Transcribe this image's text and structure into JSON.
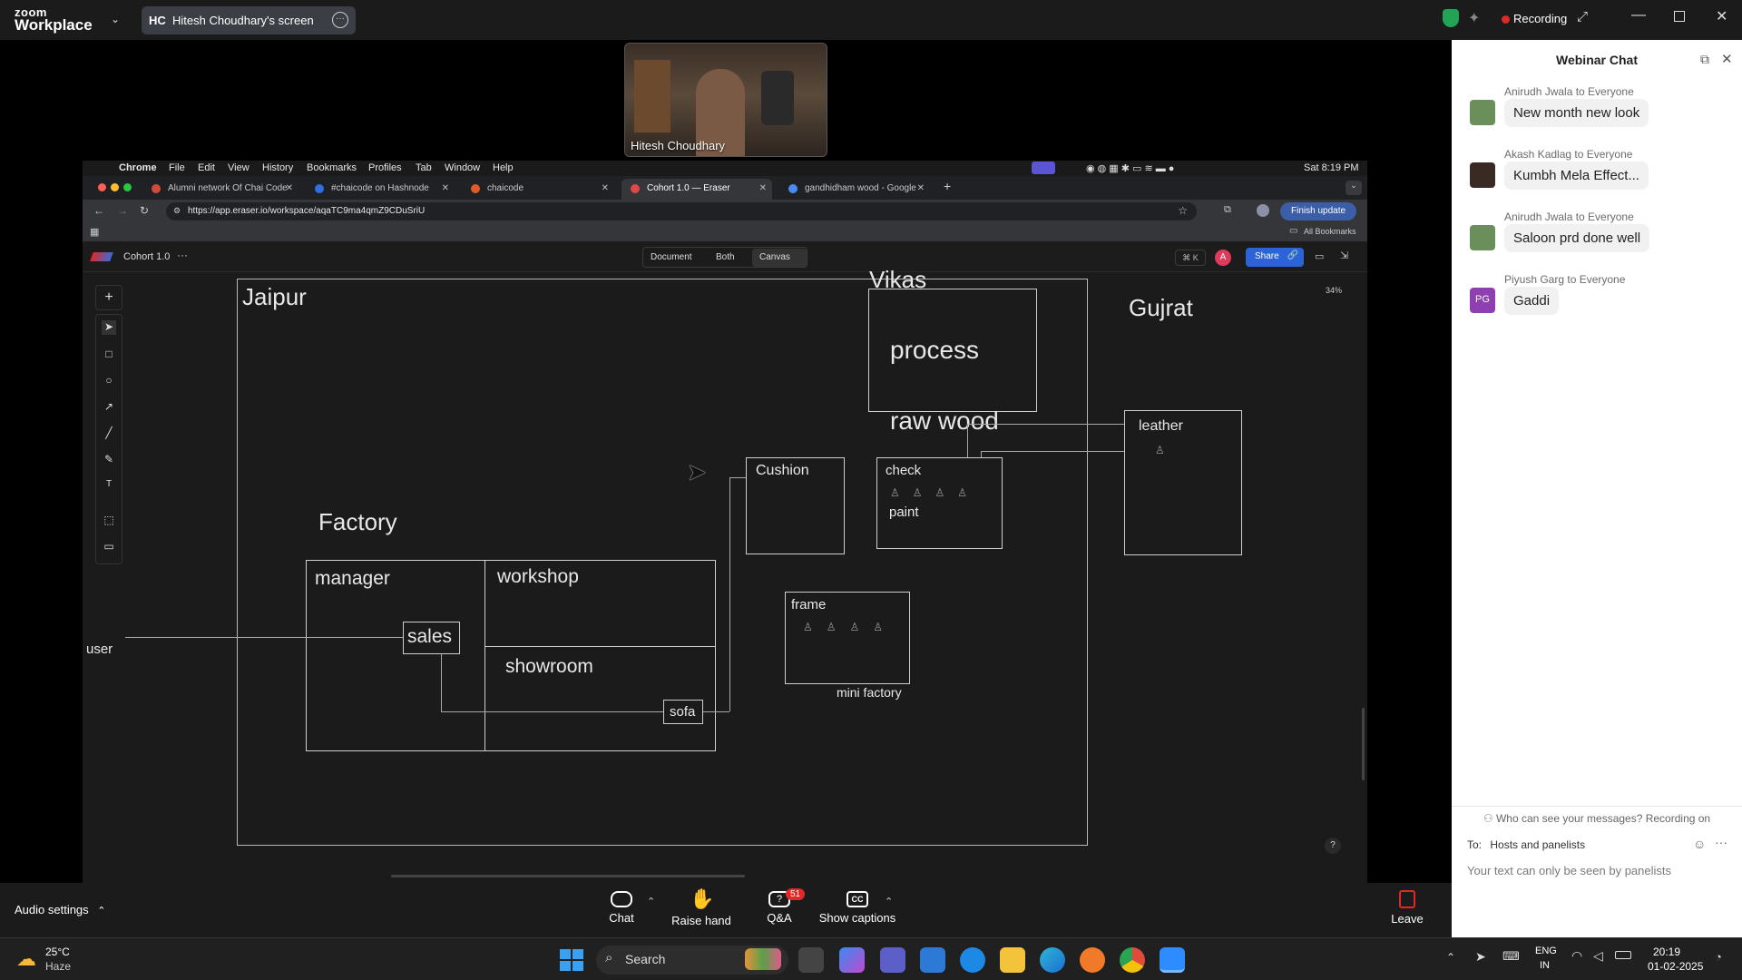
{
  "zoom": {
    "logo_top": "zoom",
    "logo_bottom": "Workplace",
    "share_initials": "HC",
    "share_title": "Hitesh Choudhary's screen",
    "recording_label": "Recording"
  },
  "video": {
    "name": "Hitesh Choudhary"
  },
  "mac_menu": {
    "app": "Chrome",
    "items": [
      "File",
      "Edit",
      "View",
      "History",
      "Bookmarks",
      "Profiles",
      "Tab",
      "Window",
      "Help"
    ],
    "clock": "Sat 8:19 PM"
  },
  "browser": {
    "tabs": [
      {
        "label": "Alumni network Of Chai Code",
        "color": "#d14b3c"
      },
      {
        "label": "#chaicode on Hashnode",
        "color": "#2f6fe0"
      },
      {
        "label": "chaicode",
        "color": "#e05a2b"
      },
      {
        "label": "Cohort 1.0 — Eraser",
        "color": "#e04848"
      },
      {
        "label": "gandhidham wood - Google",
        "color": "#4a8af4"
      }
    ],
    "url": "https://app.eraser.io/workspace/aqaTC9ma4qmZ9CDuSriU",
    "finish_update": "Finish update",
    "all_bookmarks": "All Bookmarks"
  },
  "eraser": {
    "file_title": "Cohort 1.0",
    "views": [
      "Document",
      "Both",
      "Canvas"
    ],
    "shortcut": "⌘ K",
    "avatar_letter": "A",
    "share": "Share",
    "zoom_level": "34%",
    "help": "?"
  },
  "diagram": {
    "jaipur": "Jaipur",
    "vikas": "Vikas",
    "process": "process",
    "raw_wood": "raw wood",
    "gujrat": "Gujrat",
    "leather": "leather",
    "cushion": "Cushion",
    "check": "check",
    "paint": "paint",
    "factory": "Factory",
    "manager": "manager",
    "workshop": "workshop",
    "sales": "sales",
    "showroom": "showroom",
    "sofa": "sofa",
    "user": "user",
    "frame": "frame",
    "mini_factory": "mini factory"
  },
  "chat": {
    "title": "Webinar Chat",
    "messages": [
      {
        "from": "Anirudh Jwala to Everyone",
        "text": "New month new look",
        "avatar_color": "#6a8f5a"
      },
      {
        "from": "Akash Kadlag to Everyone",
        "text": "Kumbh Mela Effect...",
        "avatar_color": "#3a2a24"
      },
      {
        "from": "Anirudh Jwala to Everyone",
        "text": "Saloon prd done well",
        "avatar_color": "#6a8f5a"
      },
      {
        "from": "Piyush Garg to Everyone",
        "text": "Gaddi",
        "avatar_color": "#8e3fb0",
        "initials": "PG"
      }
    ],
    "privacy_note": "Who can see your messages? Recording on",
    "to_label": "To:",
    "to_value": "Hosts and panelists",
    "input_placeholder": "Your text can only be seen by panelists"
  },
  "toolbar": {
    "audio": "Audio settings",
    "chat": "Chat",
    "raise_hand": "Raise hand",
    "qa": "Q&A",
    "qa_badge": "51",
    "captions": "Show captions",
    "leave": "Leave"
  },
  "taskbar": {
    "temp": "25°C",
    "weather": "Haze",
    "search": "Search",
    "lang_top": "ENG",
    "lang_bottom": "IN",
    "time": "20:19",
    "date": "01-02-2025"
  }
}
